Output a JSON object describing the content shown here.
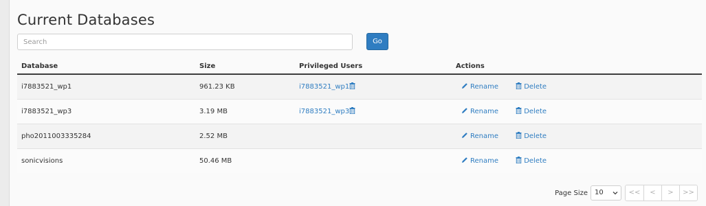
{
  "page": {
    "title": "Current Databases",
    "search_placeholder": "Search",
    "go_label": "Go"
  },
  "table": {
    "columns": [
      "Database",
      "Size",
      "Privileged Users",
      "Actions"
    ],
    "rows": [
      {
        "database": "i7883521_wp1",
        "size": "961.23 KB",
        "user": "i7883521_wp1",
        "rename": "Rename",
        "delete": "Delete"
      },
      {
        "database": "i7883521_wp3",
        "size": "3.19 MB",
        "user": "i7883521_wp3",
        "rename": "Rename",
        "delete": "Delete"
      },
      {
        "database": "pho2011003335284",
        "size": "2.52 MB",
        "user": "",
        "rename": "Rename",
        "delete": "Delete"
      },
      {
        "database": "sonicvisions",
        "size": "50.46 MB",
        "user": "",
        "rename": "Rename",
        "delete": "Delete"
      }
    ]
  },
  "pager": {
    "page_size_label": "Page Size",
    "page_size_value": "10",
    "first": "<<",
    "prev": "<",
    "next": ">",
    "last": ">>"
  },
  "colors": {
    "accent": "#2f7dc1",
    "header_rule": "#3c3c3c"
  },
  "icons": {
    "rename": "pencil-icon",
    "delete": "trash-icon",
    "remove_user": "trash-icon",
    "select": "chevron-down-icon"
  }
}
